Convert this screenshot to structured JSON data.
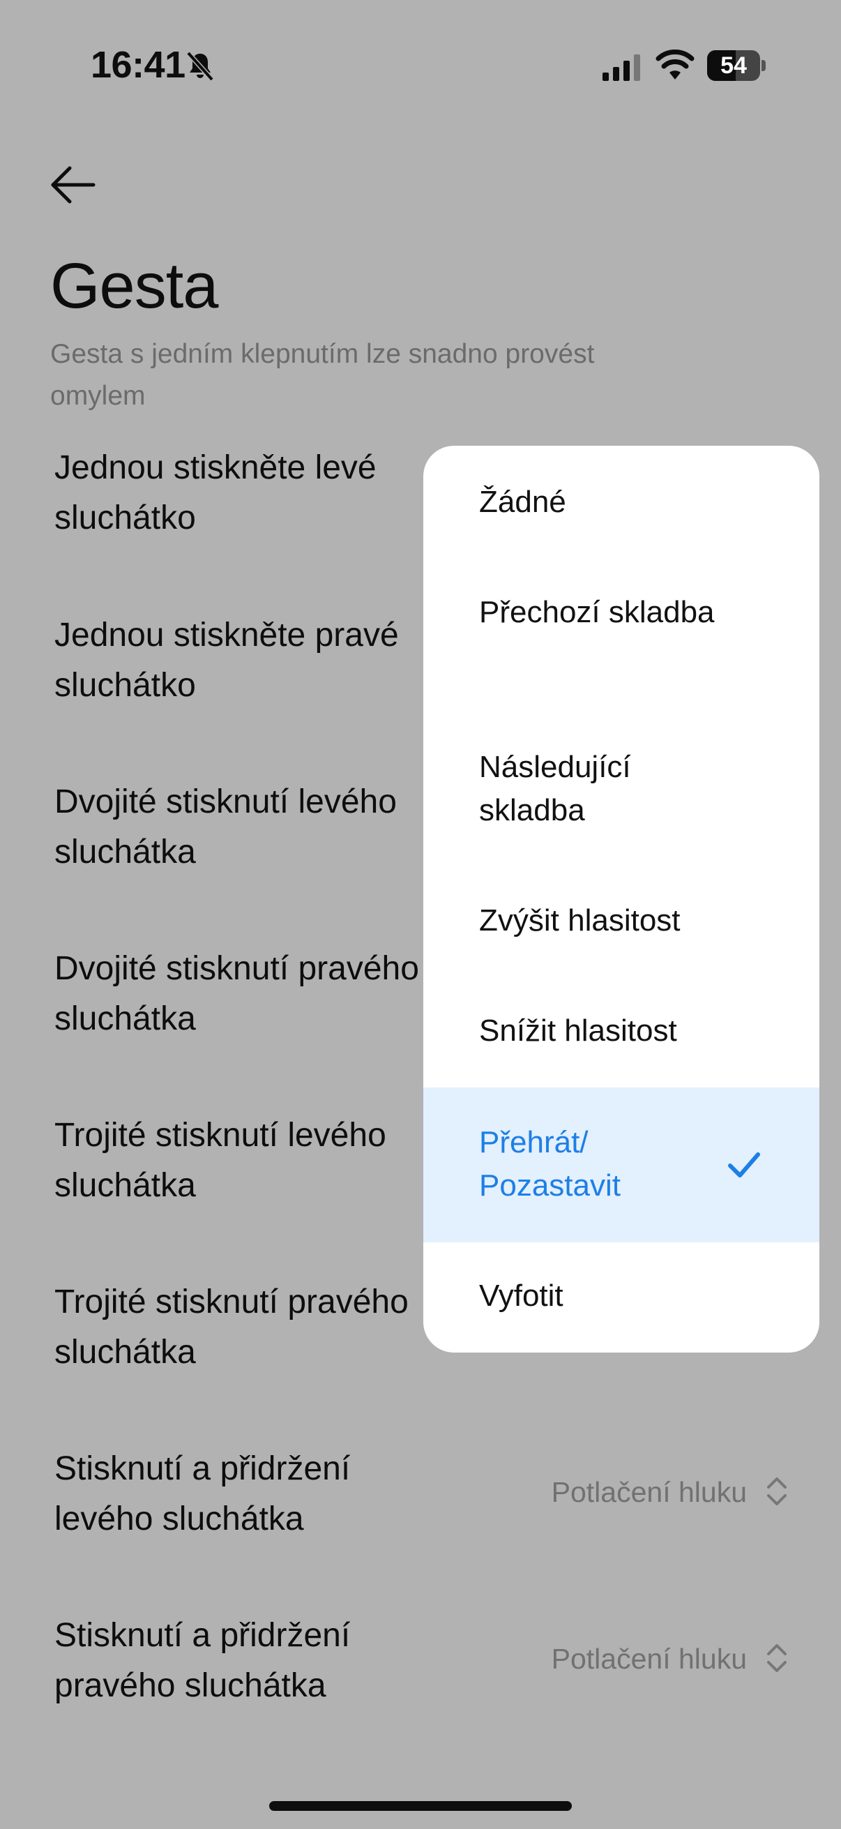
{
  "status_bar": {
    "time": "16:41",
    "battery": "54",
    "battery_level": 0.54
  },
  "header": {
    "title": "Gesta",
    "subtitle": "Gesta s jedním klepnutím lze snadno provést omylem"
  },
  "gestures": [
    {
      "label": "Jednou stiskněte levé sluchátko",
      "value": ""
    },
    {
      "label": "Jednou stiskněte pravé sluchátko",
      "value": ""
    },
    {
      "label": "Dvojité stisknutí levého sluchátka",
      "value": ""
    },
    {
      "label": "Dvojité stisknutí pravého sluchátka",
      "value": ""
    },
    {
      "label": "Trojité stisknutí levého sluchátka",
      "value": ""
    },
    {
      "label": "Trojité stisknutí pravého sluchátka",
      "value": ""
    },
    {
      "label": "Stisknutí a přidržení levého sluchátka",
      "value": "Potlačení hluku"
    },
    {
      "label": "Stisknutí a přidržení pravého sluchátka",
      "value": "Potlačení hluku"
    }
  ],
  "dropdown": {
    "selected_index": 5,
    "options": [
      {
        "label": "Žádné"
      },
      {
        "label": "Přechozí skladba"
      },
      {
        "label": "Následující skladba"
      },
      {
        "label": "Zvýšit hlasitost"
      },
      {
        "label": "Snížit hlasitost"
      },
      {
        "label": "Přehrát/ Pozastavit"
      },
      {
        "label": "Vyfotit"
      }
    ]
  },
  "colors": {
    "accent": "#1d7fe6",
    "selected_bg": "#e3f0fd",
    "scrim_bg": "#b2b2b2"
  },
  "icons": {
    "back": "arrow-left-icon",
    "mute": "bell-slash-icon",
    "signal": "cellular-signal-icon",
    "wifi": "wifi-icon",
    "battery": "battery-icon",
    "chevron": "chevron-updown-icon",
    "check": "check-icon"
  }
}
